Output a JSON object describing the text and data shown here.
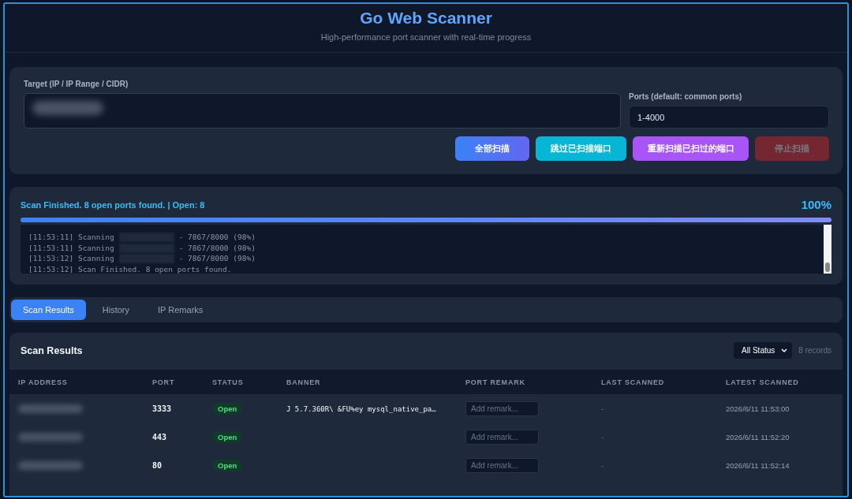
{
  "header": {
    "title": "Go Web Scanner",
    "subtitle": "High-performance port scanner with real-time progress"
  },
  "form": {
    "target_label": "Target (IP / IP Range / CIDR)",
    "ports_label": "Ports (default: common ports)",
    "ports_value": "1-4000",
    "buttons": [
      {
        "label": "全部扫描",
        "kind": "primary",
        "disabled": false
      },
      {
        "label": "跳过已扫描端口",
        "kind": "skip",
        "disabled": false
      },
      {
        "label": "重新扫描已扫过的端口",
        "kind": "rescan",
        "disabled": false
      },
      {
        "label": "停止扫描",
        "kind": "stop",
        "disabled": true
      }
    ]
  },
  "progress": {
    "status": "Scan Finished. 8 open ports found. | Open: 8",
    "percent": "100%",
    "level": 1,
    "log": [
      {
        "kind": "progress",
        "start": "[11:53:11] Scanning",
        "end": "- 7867/8000 (98%)"
      },
      {
        "kind": "progress",
        "start": "[11:53:11] Scanning",
        "end": "- 7867/8000 (98%)"
      },
      {
        "kind": "progress",
        "start": "[11:53:12] Scanning",
        "end": "- 7867/8000 (98%)"
      },
      {
        "kind": "message",
        "text": "[11:53:12] Scan Finished. 8 open ports found."
      }
    ]
  },
  "tabs": [
    {
      "label": "Scan Results",
      "selected": true
    },
    {
      "label": "History",
      "selected": false
    },
    {
      "label": "IP Remarks",
      "selected": false
    }
  ],
  "results": {
    "title": "Scan Results",
    "filter": "All Status",
    "count": "8 records",
    "columns": [
      "IP ADDRESS",
      "PORT",
      "STATUS",
      "BANNER",
      "PORT REMARK",
      "LAST SCANNED",
      "LATEST SCANNED"
    ],
    "rows": [
      {
        "port": "3333",
        "status": "Open",
        "banner": "J 5.7.360R\\ &FU%ey mysql_native_pa…",
        "remark_placeholder": "Add remark...",
        "last_scanned": "-",
        "latest_scanned": "2026/6/11 11:53:00"
      },
      {
        "port": "443",
        "status": "Open",
        "remark_placeholder": "Add remark...",
        "last_scanned": "-",
        "latest_scanned": "2026/6/11 11:52:20"
      },
      {
        "port": "80",
        "status": "Open",
        "remark_placeholder": "Add remark...",
        "last_scanned": "-",
        "latest_scanned": "2026/6/11 11:52:14"
      }
    ]
  }
}
